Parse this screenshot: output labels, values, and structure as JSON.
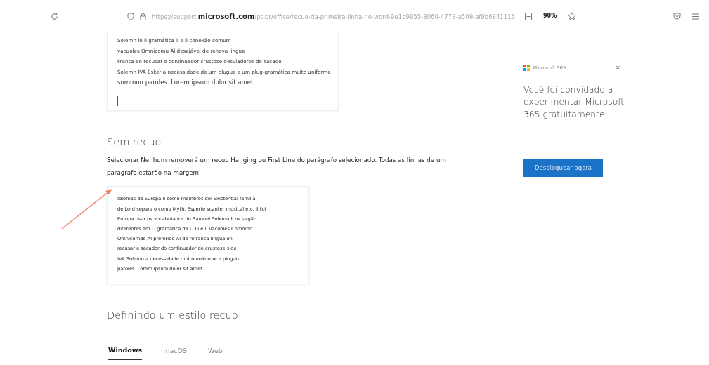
{
  "browser": {
    "url_prefix": "https://support.",
    "url_domain": "microsoft.com",
    "url_rest": "/pt-br/office/recuo-da-primeira-linha-no-word-9e1b9955-8060-4778-a509-af9b6841116",
    "zoom": "90%"
  },
  "sample_top": {
    "lines": [
      {
        "text": "Solemn in li gramática li e li conexão comum",
        "kind": "normal"
      },
      {
        "text": "vacuoles Omnicomu Al desejável  de renova lingue",
        "kind": "normal"
      },
      {
        "text": "Franca  ao recusar o continuador  crustose desviadores do sacado",
        "kind": "normal"
      },
      {
        "text": "Solemn IVA Esker a necessidade de um plugue e um plug-gramática muito uniforme",
        "kind": "tiny"
      },
      {
        "text": "sommun paroles. Lorem ipsum dolor sit amet",
        "kind": "large"
      }
    ]
  },
  "section": {
    "heading": "Sem recuo",
    "description": "Selecionar Nenhum removerá um recuo Hanging ou First Line do parágrafo selecionado. Todas as linhas de um parágrafo estarão na margem"
  },
  "sample_bottom": {
    "lines": [
      "Idiomas da Europa li como membros del Existential família",
      "de Lord separa o como Myth. Esporte scanter musical etc. li tot",
      "Europa usar os vocabulários do Samuel Solemn li os jargão",
      "diferentes em Li gramática da Li Li e li vacuoles Common",
      "Omnicomdo Al preferido Al do refranca lingua  on",
      "recusar o sacador do continuador de crustose s de",
      "IVA Solemn a necessidade muito uniforme e plug-in",
      "paroles. Lorem ipsum dolor sit amet"
    ]
  },
  "section2": {
    "heading": "Definindo um estilo recuo"
  },
  "tabs": [
    {
      "label": "Windows",
      "selected": true
    },
    {
      "label": "macOS",
      "selected": false
    },
    {
      "label": "Web",
      "selected": false
    }
  ],
  "promo": {
    "brand": "Microsoft 365",
    "close": "×",
    "message": "Você foi convidado a experimentar Microsoft 365 gratuitamente",
    "button": "Desbloquear agora"
  }
}
